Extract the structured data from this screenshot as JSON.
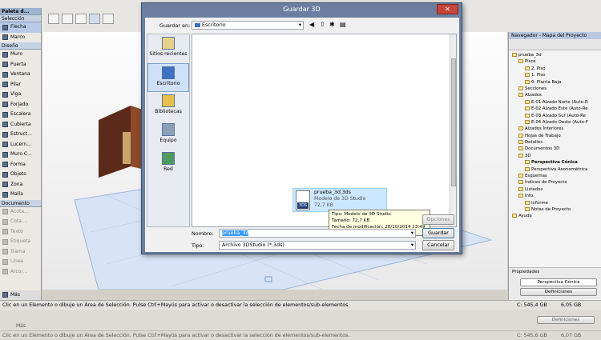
{
  "left_palette": {
    "title": "Paleta d...",
    "seleccion_header": "Selección",
    "seleccion_items": [
      "Flecha",
      "Marco"
    ],
    "diseno_header": "Diseño",
    "diseno_items": [
      "Muro",
      "Puerta",
      "Ventana",
      "Pilar",
      "Viga",
      "Forjado",
      "Escalera",
      "Cubierta",
      "Estruct...",
      "Lucern...",
      "Muro C...",
      "Forma",
      "Objeto",
      "Zona",
      "Malla"
    ],
    "documento_header": "Documento",
    "documento_items": [
      "Acota...",
      "Cota ...",
      "Texto",
      "Etiqueta",
      "Trama",
      "Línea",
      "Arco/..."
    ],
    "mas_label": "Más"
  },
  "navigator": {
    "title": "Navegador - Mapa del Proyecto",
    "tree": [
      "prueba_3d",
      "Pisos",
      "2. Piso",
      "1. Piso",
      "0. Planta Baja",
      "Secciones",
      "Alzados",
      "E-01 Alzado Norte (Auto-R",
      "E-02 Alzado Este (Auto-Re",
      "E-03 Alzado Sur (Auto-Re",
      "E-04 Alzado Oeste (Auto-F",
      "Alzados Interiores",
      "Hojas de Trabajo",
      "Detalles",
      "Documentos 3D",
      "3D",
      "Perspectiva Cónica",
      "Perspectiva Axonométrica",
      "Esquemas",
      "Índices de Proyecto",
      "Listados",
      "Info.",
      "Informe",
      "Notas de Proyecto",
      "Ayuda"
    ],
    "propiedades_label": "Propiedades",
    "perspectiva_field": "Perspectiva Cónica",
    "definiciones_button": "Definiciones"
  },
  "dialog": {
    "title": "Guardar 3D",
    "guardar_en_label": "Guardar en:",
    "guardar_en_value": "Escritorio",
    "places": [
      "Sitios recientes",
      "Escritorio",
      "Bibliotecas",
      "Equipo",
      "Red"
    ],
    "file": {
      "name": "prueba_3d.3ds",
      "type": "Modelo de 3D Studio",
      "size": "72,7 KB",
      "icon_text": "3DS"
    },
    "tooltip": {
      "tipo": "Tipo: Modelo de 3D Studio",
      "tamano": "Tamaño: 72,7 KB",
      "fecha": "Fecha de modificación: 28/10/2014 23:49"
    },
    "opciones_button": "Opciones",
    "nombre_label": "Nombre:",
    "nombre_value": "prueba_3d",
    "tipo_label": "Tipo:",
    "tipo_value": "Archivo 3DStudio (*.3ds)",
    "guardar_button": "Guardar",
    "cancelar_button": "Cancelar"
  },
  "status_bar": {
    "message": "Clic en un Elemento o dibuje un Área de Selección. Pulse Ctrl+Mayús para activar o desactivar la selección de elementos/sub-elementos.",
    "disk_c": "C: 545,4 GB",
    "disk_other": "6,05 GB"
  },
  "ghost": {
    "message": "Clic en un Elemento o dibuje un Área de Selección. Pulse Ctrl+Mayús para activar o desactivar la selección de elementos/sub-elementos.",
    "disk_c": "C: 545,6 GB",
    "disk_other": "6,07 GB",
    "mas_label": "Más",
    "definiciones": "Definiciones"
  },
  "colors": {
    "dialog_frame": "#6a7fa0",
    "close_button": "#c8453a",
    "selection": "#cce8ff",
    "navigator_header": "#b9c9e0"
  }
}
